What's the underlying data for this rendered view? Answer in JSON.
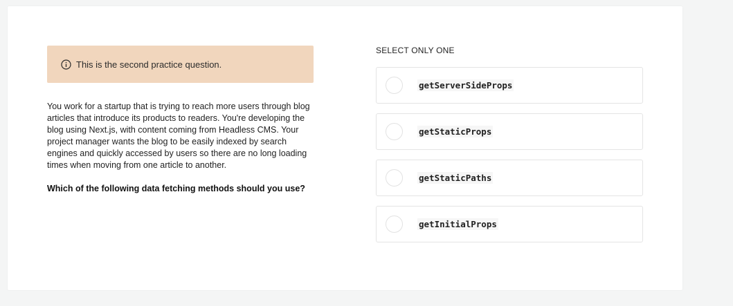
{
  "notice": {
    "icon": "info-icon",
    "text": "This is the second practice question."
  },
  "prompt": {
    "body": "You work for a startup that is trying to reach more users through blog articles that introduce its products to readers. You're developing the blog using Next.js, with content coming from Headless CMS. Your project manager wants the blog to be easily indexed by search engines and quickly accessed by users so there are no long loading times when moving from one article to another.",
    "question": "Which of the following data fetching methods should you use?"
  },
  "answers": {
    "instruction": "SELECT ONLY ONE",
    "options": [
      {
        "label": "getServerSideProps",
        "selected": false
      },
      {
        "label": "getStaticProps",
        "selected": false
      },
      {
        "label": "getStaticPaths",
        "selected": false
      },
      {
        "label": "getInitialProps",
        "selected": false
      }
    ]
  },
  "colors": {
    "notice_bg": "#f1d6bd",
    "page_bg": "#f4f5f5",
    "card_bg": "#ffffff"
  }
}
